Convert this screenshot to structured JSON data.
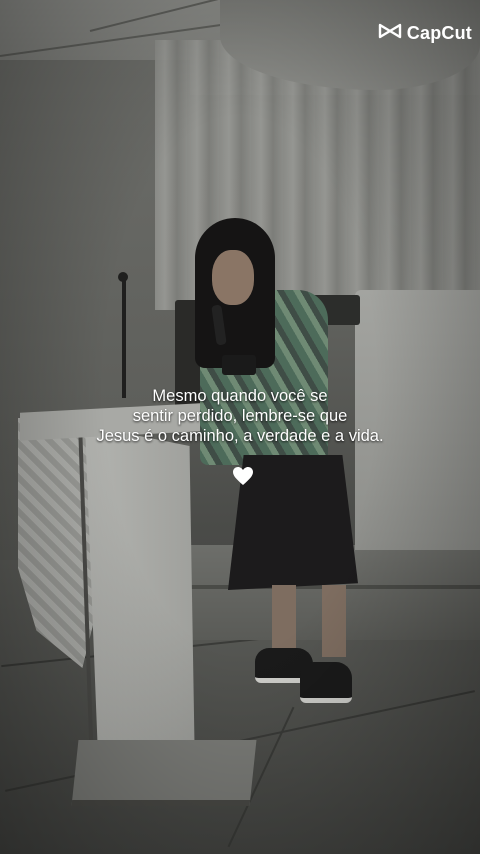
{
  "watermark": {
    "brand": "CapCut",
    "icon": "capcut-logo-icon"
  },
  "caption": {
    "lines": [
      "Mesmo quando você se",
      "sentir perdido, lembre-se que",
      "Jesus é o caminho, a verdade e a vida."
    ],
    "emoji": "heart-icon",
    "color": "#ffffff"
  }
}
